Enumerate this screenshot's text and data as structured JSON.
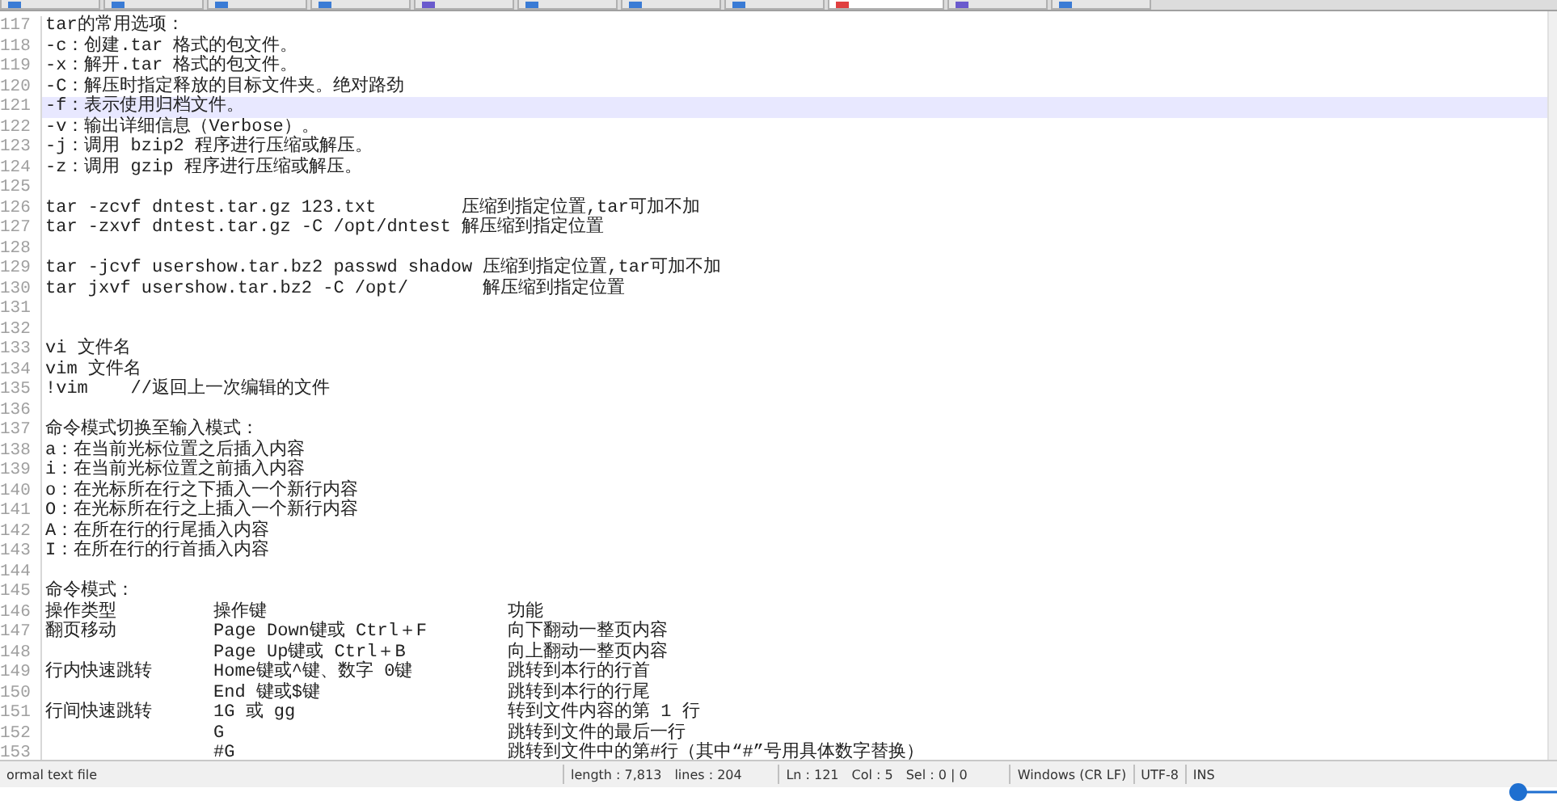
{
  "tabs": [
    {
      "selected": false,
      "color": "#3a7bd5"
    },
    {
      "selected": false,
      "color": "#3a7bd5"
    },
    {
      "selected": false,
      "color": "#3a7bd5"
    },
    {
      "selected": false,
      "color": "#3a7bd5"
    },
    {
      "selected": false,
      "color": "#6a5acd"
    },
    {
      "selected": false,
      "color": "#3a7bd5"
    },
    {
      "selected": false,
      "color": "#3a7bd5"
    },
    {
      "selected": false,
      "color": "#3a7bd5"
    },
    {
      "selected": true,
      "color": "#e04040"
    },
    {
      "selected": false,
      "color": "#6a5acd"
    },
    {
      "selected": false,
      "color": "#3a7bd5"
    }
  ],
  "lines": [
    {
      "number": "117",
      "kind": "text",
      "current": false,
      "text": "tar的常用选项："
    },
    {
      "number": "118",
      "kind": "text",
      "current": false,
      "text": "-c：创建.tar 格式的包文件。"
    },
    {
      "number": "119",
      "kind": "text",
      "current": false,
      "text": "-x：解开.tar 格式的包文件。"
    },
    {
      "number": "120",
      "kind": "text",
      "current": false,
      "text": "-C：解压时指定释放的目标文件夹。绝对路劲"
    },
    {
      "number": "121",
      "kind": "text",
      "current": true,
      "text": "-f：表示使用归档文件。"
    },
    {
      "number": "122",
      "kind": "text",
      "current": false,
      "text": "-v：输出详细信息（Verbose）。"
    },
    {
      "number": "123",
      "kind": "text",
      "current": false,
      "text": "-j：调用 bzip2 程序进行压缩或解压。"
    },
    {
      "number": "124",
      "kind": "text",
      "current": false,
      "text": "-z：调用 gzip 程序进行压缩或解压。"
    },
    {
      "number": "125",
      "kind": "text",
      "current": false
    },
    {
      "number": "126",
      "kind": "text",
      "current": false,
      "text": "tar -zcvf dntest.tar.gz 123.txt        压缩到指定位置,tar可加不加"
    },
    {
      "number": "127",
      "kind": "text",
      "current": false,
      "text": "tar -zxvf dntest.tar.gz -C /opt/dntest 解压缩到指定位置"
    },
    {
      "number": "128",
      "kind": "text",
      "current": false
    },
    {
      "number": "129",
      "kind": "text",
      "current": false,
      "text": "tar -jcvf usershow.tar.bz2 passwd shadow 压缩到指定位置,tar可加不加"
    },
    {
      "number": "130",
      "kind": "text",
      "current": false,
      "text": "tar jxvf usershow.tar.bz2 -C /opt/       解压缩到指定位置"
    },
    {
      "number": "131",
      "kind": "text",
      "current": false
    },
    {
      "number": "132",
      "kind": "text",
      "current": false
    },
    {
      "number": "133",
      "kind": "text",
      "current": false,
      "text": "vi 文件名"
    },
    {
      "number": "134",
      "kind": "text",
      "current": false,
      "text": "vim 文件名"
    },
    {
      "number": "135",
      "kind": "text",
      "current": false,
      "text": "!vim    //返回上一次编辑的文件"
    },
    {
      "number": "136",
      "kind": "text",
      "current": false
    },
    {
      "number": "137",
      "kind": "text",
      "current": false,
      "text": "命令模式切换至输入模式："
    },
    {
      "number": "138",
      "kind": "text",
      "current": false,
      "text": "a：在当前光标位置之后插入内容"
    },
    {
      "number": "139",
      "kind": "text",
      "current": false,
      "text": "i：在当前光标位置之前插入内容"
    },
    {
      "number": "140",
      "kind": "text",
      "current": false,
      "text": "o：在光标所在行之下插入一个新行内容"
    },
    {
      "number": "141",
      "kind": "text",
      "current": false,
      "text": "O：在光标所在行之上插入一个新行内容"
    },
    {
      "number": "142",
      "kind": "text",
      "current": false,
      "text": "A：在所在行的行尾插入内容"
    },
    {
      "number": "143",
      "kind": "text",
      "current": false,
      "text": "I：在所在行的行首插入内容"
    },
    {
      "number": "144",
      "kind": "text",
      "current": false
    },
    {
      "number": "145",
      "kind": "text",
      "current": false,
      "text": "命令模式："
    },
    {
      "number": "146",
      "kind": "columns",
      "current": false,
      "column_1": "操作类型",
      "column_2": "操作键",
      "column_3": "功能"
    },
    {
      "number": "147",
      "kind": "columns",
      "current": false,
      "column_1": "翻页移动",
      "column_2": "Page Down键或 Ctrl＋F",
      "column_3": "向下翻动一整页内容"
    },
    {
      "number": "148",
      "kind": "columns",
      "current": false,
      "column_2": "Page Up键或 Ctrl＋B",
      "column_3": "向上翻动一整页内容"
    },
    {
      "number": "149",
      "kind": "columns",
      "current": false,
      "column_1": "行内快速跳转",
      "column_2": "Home键或^键、数字 0键",
      "column_3": "跳转到本行的行首"
    },
    {
      "number": "150",
      "kind": "columns",
      "current": false,
      "column_2": "End 键或$键",
      "column_3": "跳转到本行的行尾"
    },
    {
      "number": "151",
      "kind": "columns",
      "current": false,
      "column_1": "行间快速跳转",
      "column_2": "1G 或 gg",
      "column_3": "转到文件内容的第 1 行"
    },
    {
      "number": "152",
      "kind": "columns",
      "current": false,
      "column_2": "G",
      "column_3": "跳转到文件的最后一行"
    },
    {
      "number": "153",
      "kind": "columns",
      "current": false,
      "column_2": "#G",
      "column_3": "跳转到文件中的第#行（其中“#”号用具体数字替换）"
    }
  ],
  "status_bar": {
    "file_type": "ormal text file",
    "length": "length : 7,813",
    "lines": "lines : 204",
    "ln": "Ln : 121",
    "col": "Col : 5",
    "sel": "Sel : 0 | 0",
    "eol": "Windows (CR LF)",
    "encoding": "UTF-8",
    "mode": "INS"
  }
}
